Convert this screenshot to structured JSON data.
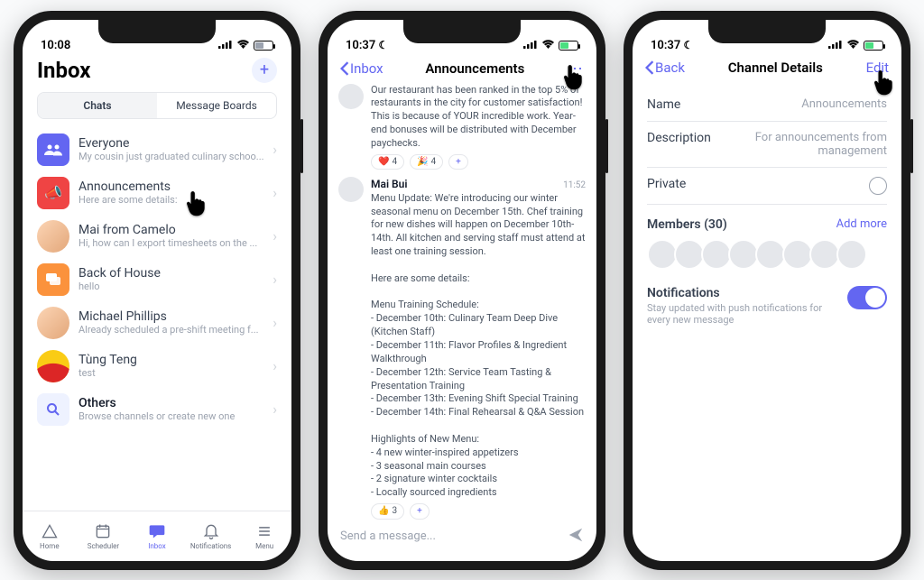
{
  "phone1": {
    "status": {
      "time": "10:08",
      "battery_pct": 50,
      "battery_color": "#9ca3af",
      "moon": false
    },
    "title": "Inbox",
    "tabs": [
      "Chats",
      "Message Boards"
    ],
    "chats": [
      {
        "name": "Everyone",
        "sub": "My cousin just graduated culinary schoo..."
      },
      {
        "name": "Announcements",
        "sub": "Here are some details:"
      },
      {
        "name": "Mai from Camelo",
        "sub": "Hi, how can I export timesheets on the ..."
      },
      {
        "name": "Back of House",
        "sub": "hello"
      },
      {
        "name": "Michael Phillips",
        "sub": "Already scheduled a pre-shift meeting f..."
      },
      {
        "name": "Tùng Teng",
        "sub": "test"
      },
      {
        "name": "Others",
        "sub": "Browse channels or create new one"
      }
    ],
    "nav": [
      "Home",
      "Scheduler",
      "Inbox",
      "Notifications",
      "Menu"
    ]
  },
  "phone2": {
    "status": {
      "time": "10:37",
      "battery_pct": 50,
      "battery_color": "#4ade80",
      "moon": true
    },
    "back": "Inbox",
    "title": "Announcements",
    "msg1": {
      "text": "Our restaurant has been ranked in the top 5% of restaurants in the city for customer satisfaction! This is because of YOUR incredible work. Year-end bonuses will be distributed with December paychecks.",
      "reactions": [
        {
          "emoji": "❤️",
          "count": 4
        },
        {
          "emoji": "🎉",
          "count": 4
        }
      ]
    },
    "msg2": {
      "name": "Mai Bui",
      "time": "11:52",
      "text": "Menu Update: We're introducing our winter seasonal menu on December 15th. Chef training for new dishes will happen on December 10th-14th. All kitchen and serving staff must attend at least one training session.\n\nHere are some details:\n\nMenu Training Schedule:\n- December 10th: Culinary Team Deep Dive (Kitchen Staff)\n- December 11th: Flavor Profiles & Ingredient Walkthrough\n- December 12th: Service Team Tasting & Presentation Training\n- December 13th: Evening Shift Special Training\n- December 14th: Final Rehearsal & Q&A Session\n\nHighlights of New Menu:\n- 4 new winter-inspired appetizers\n- 3 seasonal main courses\n- 2 signature winter cocktails\n- Locally sourced ingredients",
      "reactions": [
        {
          "emoji": "👍",
          "count": 3
        }
      ]
    },
    "composer_placeholder": "Send a message..."
  },
  "phone3": {
    "status": {
      "time": "10:37",
      "battery_pct": 50,
      "battery_color": "#4ade80",
      "moon": true
    },
    "back": "Back",
    "title": "Channel Details",
    "edit": "Edit",
    "rows": {
      "name_label": "Name",
      "name_value": "Announcements",
      "desc_label": "Description",
      "desc_value": "For announcements from management",
      "priv_label": "Private"
    },
    "members": {
      "label": "Members (30)",
      "add": "Add more",
      "count": 8
    },
    "notif": {
      "title": "Notifications",
      "sub": "Stay updated with push notifications for every new message"
    }
  }
}
